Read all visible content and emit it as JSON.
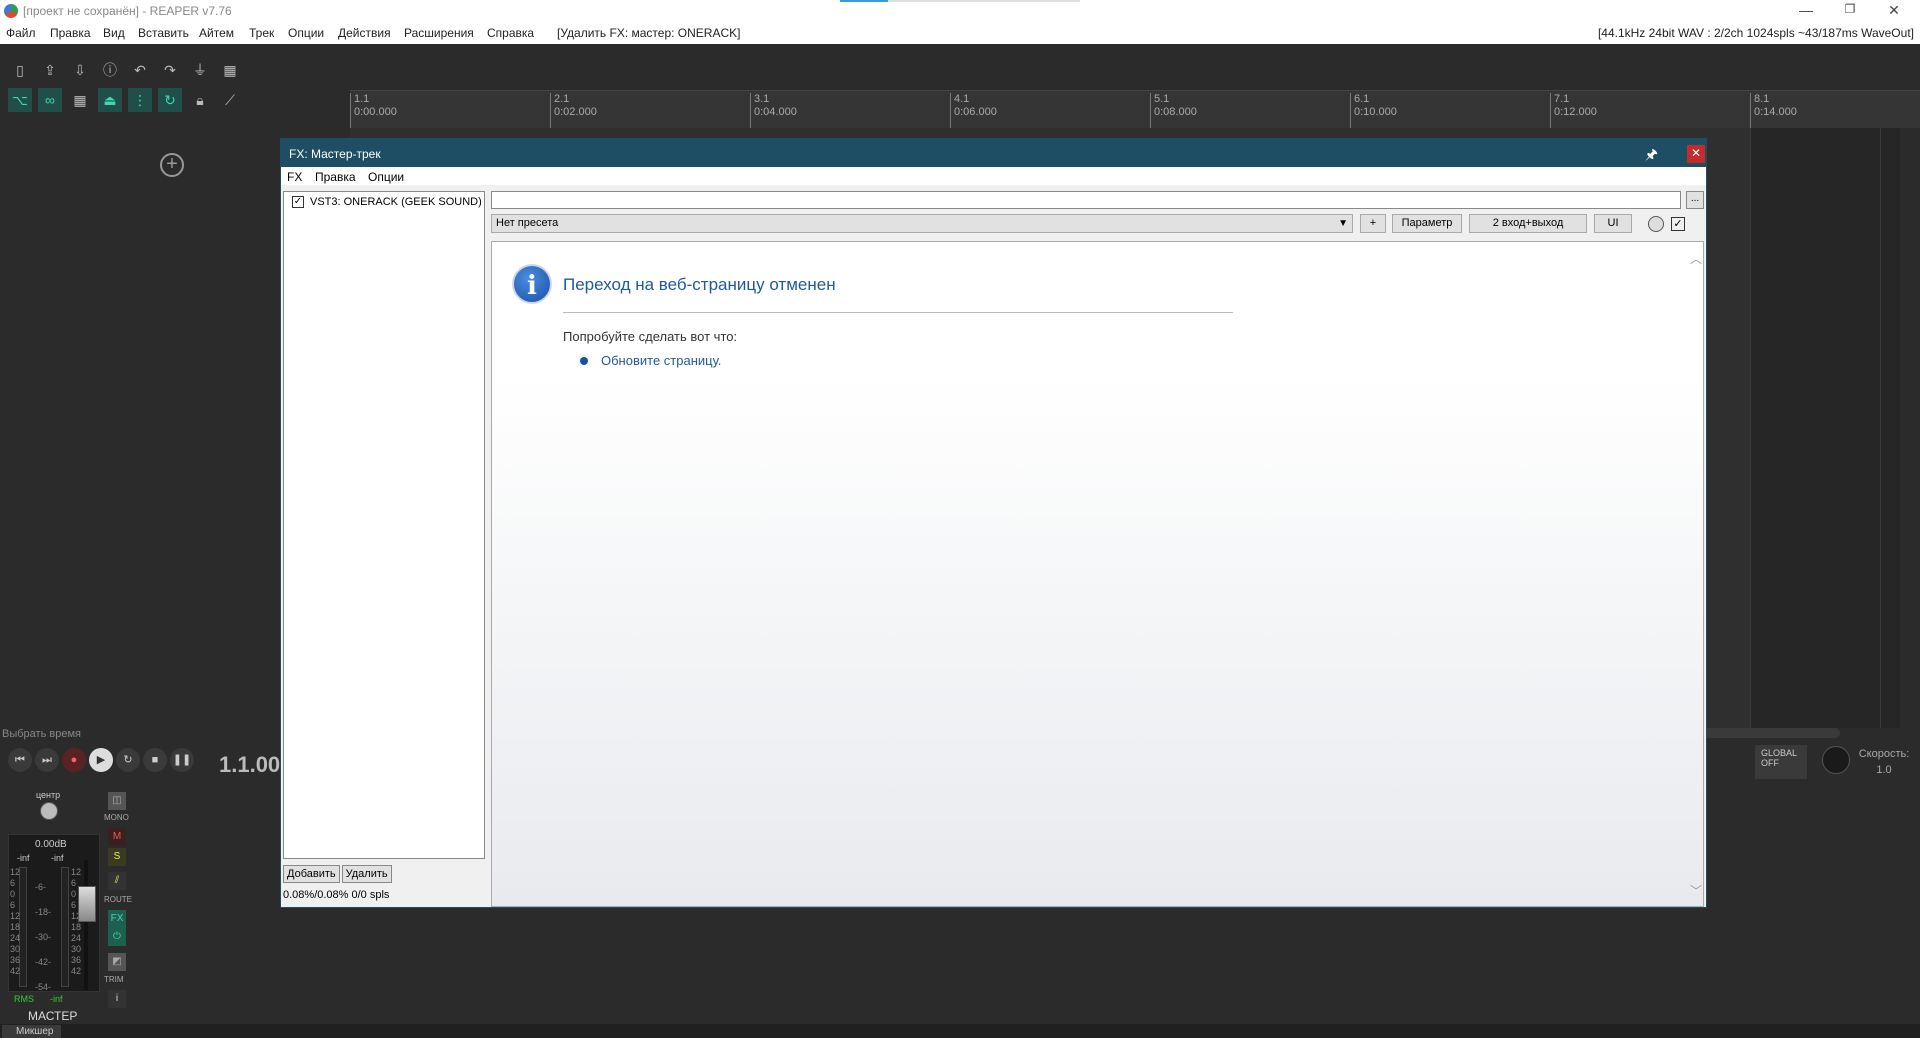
{
  "window": {
    "title": "[проект не сохранён] - REAPER v7.76",
    "minimize": "—",
    "restore": "❐",
    "close": "✕"
  },
  "menu": {
    "items": [
      "Файл",
      "Правка",
      "Вид",
      "Вставить",
      "Айтем",
      "Трек",
      "Опции",
      "Действия",
      "Расширения",
      "Справка"
    ],
    "undo_hint": "[Удалить FX: мастер: ONERACK]",
    "audio_info": "[44.1kHz 24bit WAV : 2/2ch 1024spls ~43/187ms WaveOut]"
  },
  "timeline": {
    "ticks": [
      {
        "bar": "1.1",
        "time": "0:00.000"
      },
      {
        "bar": "2.1",
        "time": "0:02.000"
      },
      {
        "bar": "3.1",
        "time": "0:04.000"
      },
      {
        "bar": "4.1",
        "time": "0:06.000"
      },
      {
        "bar": "5.1",
        "time": "0:08.000"
      },
      {
        "bar": "6.1",
        "time": "0:10.000"
      },
      {
        "bar": "7.1",
        "time": "0:12.000"
      },
      {
        "bar": "8.1",
        "time": "0:14.000"
      }
    ]
  },
  "transport": {
    "select_label": "Выбрать время",
    "time": "1.1.00",
    "speed_label": "Скорость:",
    "speed_value": "1.0",
    "global_label": "GLOBAL",
    "global_state": "OFF"
  },
  "mixer": {
    "pan_label": "центр",
    "volume": "0.00dB",
    "peak_left": "-inf",
    "peak_right": "-inf",
    "scale": [
      "12",
      "6",
      "0",
      "6",
      "12",
      "18",
      "24",
      "30",
      "36",
      "42"
    ],
    "scale_mid": [
      "-6-",
      "-18-",
      "-30-",
      "-42-",
      "-54-"
    ],
    "rms_label": "RMS",
    "rms_value": "-inf",
    "mono": "MONO",
    "mute": "M",
    "solo": "S",
    "route": "ROUTE",
    "fx": "FX",
    "trim": "TRIM",
    "info": "i",
    "name": "МАСТЕР",
    "tab": "Микшер"
  },
  "fx": {
    "title": "FX: Мастер-трек",
    "pin": "🖈",
    "close": "✕",
    "menu": [
      "FX",
      "Правка",
      "Опции"
    ],
    "plugin": "VST3: ONERACK (GEEK SOUND)",
    "add": "Добавить",
    "remove": "Удалить",
    "stats": "0.08%/0.08% 0/0 spls",
    "name_value": "",
    "dots": "...",
    "preset": "Нет пресета",
    "plus": "+",
    "param": "Параметр",
    "io": "2 вход+выход",
    "ui": "UI"
  },
  "webpage": {
    "title": "Переход на веб-страницу отменен",
    "try": "Попробуйте сделать вот что:",
    "link": "Обновите страницу."
  }
}
